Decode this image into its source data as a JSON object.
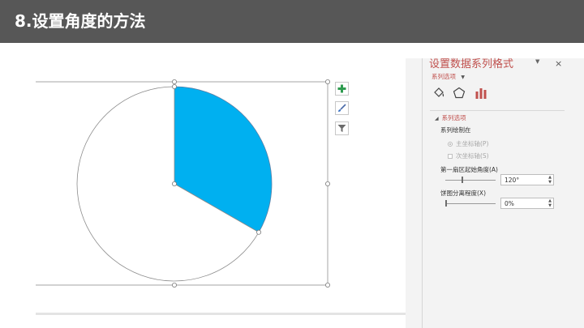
{
  "slide": {
    "title": "8.设置角度的方法"
  },
  "colors": {
    "header_bg": "#575757",
    "slice_fill": "#00b0f0",
    "accent_red": "#c0504d",
    "panel_bg": "#f3f3f3"
  },
  "chart_data": {
    "type": "pie",
    "first_slice_angle_deg": 120,
    "slices": [
      {
        "label": "",
        "value": 33.3,
        "fill": "#00b0f0"
      },
      {
        "label": "",
        "value": 66.7,
        "fill": "#ffffff"
      }
    ],
    "selected": true
  },
  "chart_tools": {
    "elements_icon": "plus-icon",
    "styles_icon": "brush-icon",
    "filters_icon": "filter-icon"
  },
  "format_panel": {
    "title": "设置数据系列格式",
    "subtitle": "系列选项",
    "subtitle_arrow": "▼",
    "pin": "▼",
    "close": "×",
    "tabs": [
      {
        "icon": "fill-bucket-icon"
      },
      {
        "icon": "pentagon-effects-icon"
      },
      {
        "icon": "bar-chart-icon",
        "active": true
      }
    ],
    "section": {
      "header": "系列选项",
      "plot_on_label": "系列绘制在",
      "primary_axis": "主坐标轴(P)",
      "secondary_axis": "次坐标轴(S)",
      "angle_label": "第一扇区起始角度(A)",
      "angle_value": "120°",
      "angle_fraction": 0.333,
      "explosion_label": "饼图分离程度(X)",
      "explosion_value": "0%",
      "explosion_fraction": 0.0
    }
  }
}
